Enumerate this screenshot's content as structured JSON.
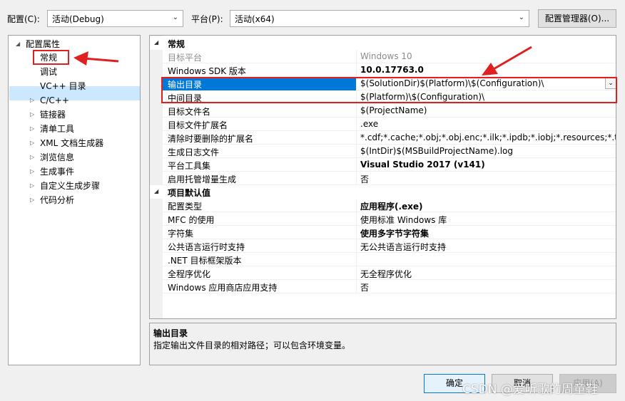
{
  "toolbar": {
    "config_label": "配置(C):",
    "config_value": "活动(Debug)",
    "platform_label": "平台(P):",
    "platform_value": "活动(x64)",
    "config_manager_btn": "配置管理器(O)..."
  },
  "tree": {
    "root": "配置属性",
    "items": [
      {
        "label": "常规",
        "expandable": false,
        "selected": true
      },
      {
        "label": "调试",
        "expandable": false
      },
      {
        "label": "VC++ 目录",
        "expandable": false
      },
      {
        "label": "C/C++",
        "expandable": true
      },
      {
        "label": "链接器",
        "expandable": true
      },
      {
        "label": "清单工具",
        "expandable": true
      },
      {
        "label": "XML 文档生成器",
        "expandable": true
      },
      {
        "label": "浏览信息",
        "expandable": true
      },
      {
        "label": "生成事件",
        "expandable": true
      },
      {
        "label": "自定义生成步骤",
        "expandable": true
      },
      {
        "label": "代码分析",
        "expandable": true
      }
    ]
  },
  "grid": {
    "cat_general": "常规",
    "general_rows": [
      {
        "name": "目标平台",
        "value": "Windows 10"
      },
      {
        "name": "Windows SDK 版本",
        "value": "10.0.17763.0"
      },
      {
        "name": "输出目录",
        "value": "$(SolutionDir)$(Platform)\\$(Configuration)\\"
      },
      {
        "name": "中间目录",
        "value": "$(Platform)\\$(Configuration)\\"
      },
      {
        "name": "目标文件名",
        "value": "$(ProjectName)"
      },
      {
        "name": "目标文件扩展名",
        "value": ".exe"
      },
      {
        "name": "清除时要删除的扩展名",
        "value": "*.cdf;*.cache;*.obj;*.obj.enc;*.ilk;*.ipdb;*.iobj;*.resources;*.tlb;*.tli;*.t"
      },
      {
        "name": "生成日志文件",
        "value": "$(IntDir)$(MSBuildProjectName).log"
      },
      {
        "name": "平台工具集",
        "value": "Visual Studio 2017 (v141)"
      },
      {
        "name": "启用托管增量生成",
        "value": "否"
      }
    ],
    "cat_defaults": "项目默认值",
    "default_rows": [
      {
        "name": "配置类型",
        "value": "应用程序(.exe)"
      },
      {
        "name": "MFC 的使用",
        "value": "使用标准 Windows 库"
      },
      {
        "name": "字符集",
        "value": "使用多字节字符集"
      },
      {
        "name": "公共语言运行时支持",
        "value": "无公共语言运行时支持"
      },
      {
        "name": ".NET 目标框架版本",
        "value": ""
      },
      {
        "name": "全程序优化",
        "value": "无全程序优化"
      },
      {
        "name": "Windows 应用商店应用支持",
        "value": "否"
      }
    ]
  },
  "description": {
    "title": "输出目录",
    "text": "指定输出文件目录的相对路径；可以包含环境变量。"
  },
  "buttons": {
    "ok": "确定",
    "cancel": "取消",
    "apply": "应用(A)"
  },
  "watermark": "CSDN @爱听歌的周童鞋",
  "colors": {
    "highlight": "#0078d7",
    "annotation_red": "#e02020"
  }
}
